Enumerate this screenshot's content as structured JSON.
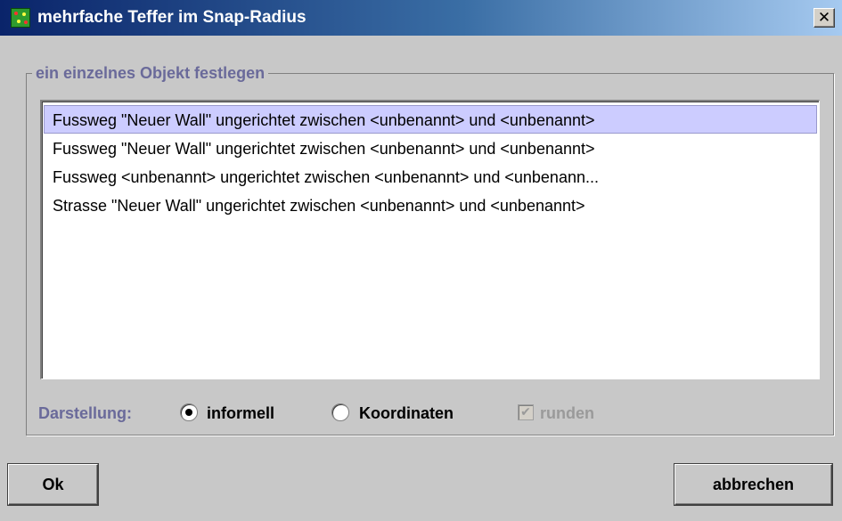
{
  "window": {
    "title": "mehrfache Teffer im Snap-Radius",
    "close_glyph": "✕"
  },
  "group": {
    "legend": "ein einzelnes Objekt festlegen"
  },
  "list": {
    "items": [
      "Fussweg \"Neuer Wall\" ungerichtet zwischen <unbenannt> und <unbenannt>",
      "Fussweg \"Neuer Wall\" ungerichtet zwischen <unbenannt> und <unbenannt>",
      "Fussweg <unbenannt> ungerichtet zwischen <unbenannt> und <unbenann...",
      "Strasse \"Neuer Wall\" ungerichtet zwischen <unbenannt> und <unbenannt>"
    ],
    "selected_index": 0
  },
  "options": {
    "label": "Darstellung:",
    "informell": "informell",
    "koordinaten": "Koordinaten",
    "runden": "runden",
    "selected": "informell",
    "runden_checked": true,
    "runden_enabled": false
  },
  "buttons": {
    "ok": "Ok",
    "cancel": "abbrechen"
  },
  "colors": {
    "title_gradient_start": "#0a246a",
    "title_gradient_end": "#a6caf0",
    "selection": "#ccccff",
    "label_color": "#6a6a9a"
  },
  "icons": {
    "app": "app-icon",
    "close": "close-icon"
  }
}
